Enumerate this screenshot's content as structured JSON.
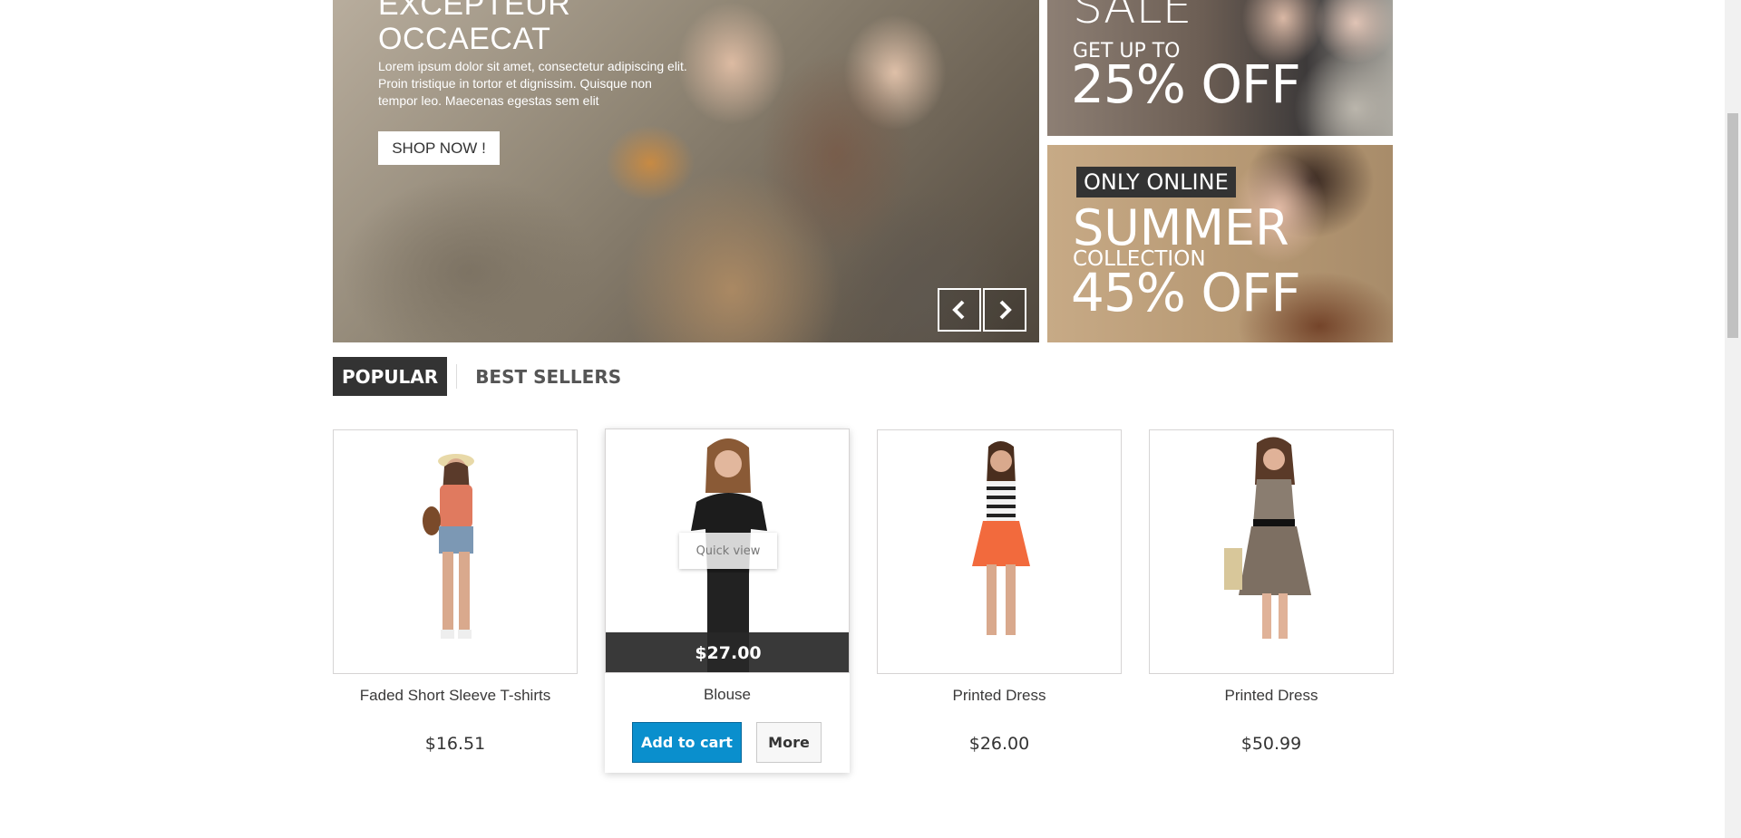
{
  "slider": {
    "title": "EXCEPTEUR OCCAECAT",
    "text": "Lorem ipsum dolor sit amet, consectetur adipiscing elit. Proin tristique in tortor et dignissim. Quisque non tempor leo. Maecenas egestas sem elit",
    "button": "SHOP NOW !",
    "prev_icon": "chevron-left-icon",
    "next_icon": "chevron-right-icon"
  },
  "banners": {
    "top": {
      "headline": "SALE",
      "subline": "GET UP TO",
      "offer": "25% OFF"
    },
    "bottom": {
      "badge": "ONLY ONLINE",
      "headline": "SUMMER",
      "subline": "COLLECTION",
      "offer": "45% OFF"
    }
  },
  "tabs": [
    {
      "label": "POPULAR",
      "active": true
    },
    {
      "label": "BEST SELLERS",
      "active": false
    }
  ],
  "products": [
    {
      "name": "Faded Short Sleeve T-shirts",
      "price": "$16.51"
    },
    {
      "name": "Blouse",
      "price": "$27.00",
      "quick_view": "Quick view",
      "add_to_cart": "Add to cart",
      "more": "More"
    },
    {
      "name": "Printed Dress",
      "price": "$26.00"
    },
    {
      "name": "Printed Dress",
      "price": "$50.99"
    }
  ],
  "colors": {
    "accent": "#0a8fcd",
    "dark": "#333333"
  }
}
